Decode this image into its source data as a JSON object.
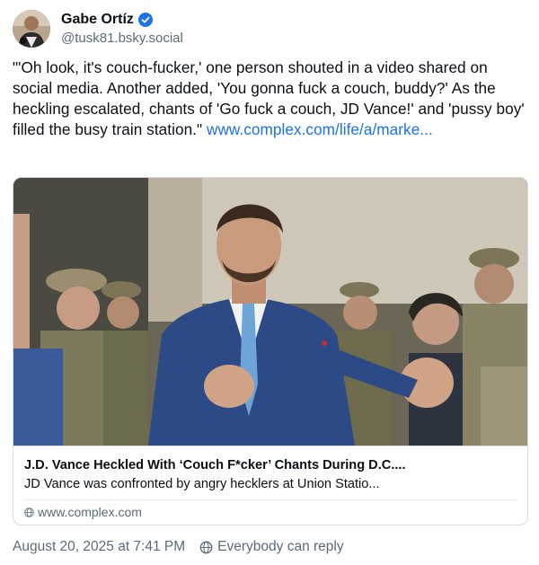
{
  "author": {
    "display_name": "Gabe Ortíz",
    "handle": "@tusk81.bsky.social",
    "verified": true
  },
  "post": {
    "text": "\"'Oh look, it's couch-fucker,' one person shouted in a video shared on social media. Another added, 'You gonna fuck a couch, buddy?' As the heckling escalated, chants of 'Go fuck a couch, JD Vance!' and 'pussy boy' filled the busy train station.\"",
    "link_text": "www.complex.com/life/a/marke..."
  },
  "link_card": {
    "title": "J.D. Vance Heckled With ‘Couch F*cker’ Chants During D.C....",
    "description": "JD Vance was confronted by angry hecklers at Union Statio...",
    "domain": "www.complex.com"
  },
  "footer": {
    "timestamp": "August 20, 2025 at 7:41 PM",
    "reply_setting": "Everybody can reply"
  },
  "colors": {
    "link": "#1a73e8",
    "verified_badge": "#1a73e8",
    "muted_text": "#5b6b7a",
    "border": "#d4dbe2"
  }
}
